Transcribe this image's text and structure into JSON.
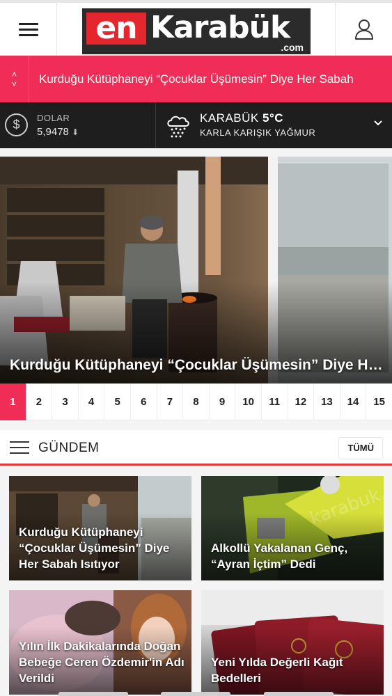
{
  "header": {
    "logo_en": "en",
    "logo_name": "Karabük",
    "logo_domain": ".com",
    "menu_icon": "hamburger-icon",
    "user_icon": "user-icon"
  },
  "ticker": {
    "text": "Kurduğu Kütüphaneyi “Çocuklar Üşümesin” Diye Her Sabah",
    "up_arrow": "˄",
    "down_arrow": "˅",
    "color": "#ef2d56"
  },
  "currency": {
    "label": "DOLAR",
    "value": "5,9478",
    "trend": "⬇",
    "icon": "dollar-icon"
  },
  "weather": {
    "city": "KARABÜK",
    "temp": "5°C",
    "condition": "KARLA KARIŞIK YAĞMUR",
    "icon": "snow-rain-cloud-icon"
  },
  "slider": {
    "title": "Kurduğu Kütüphaneyi “Çocuklar Üşümesin” Diye Her Sabah Isıtıyor",
    "pages": [
      "1",
      "2",
      "3",
      "4",
      "5",
      "6",
      "7",
      "8",
      "9",
      "10",
      "11",
      "12",
      "13",
      "14",
      "15"
    ],
    "active_page": "1"
  },
  "section": {
    "title": "GÜNDEM",
    "all_label": "TÜMÜ",
    "accent": "#e03a3a"
  },
  "cards": [
    {
      "title": "Kurduğu Kütüphaneyi “Çocuklar Üşümesin” Diye Her Sabah Isıtıyor"
    },
    {
      "title": "Alkollü Yakalanan Genç, “Ayran İçtim” Dedi"
    },
    {
      "title": "Yılın İlk Dakikalarında Doğan Bebeğe Ceren Özdemir'in Adı Verildi"
    },
    {
      "title": "Yeni Yılda Değerli Kağıt Bedelleri"
    }
  ]
}
